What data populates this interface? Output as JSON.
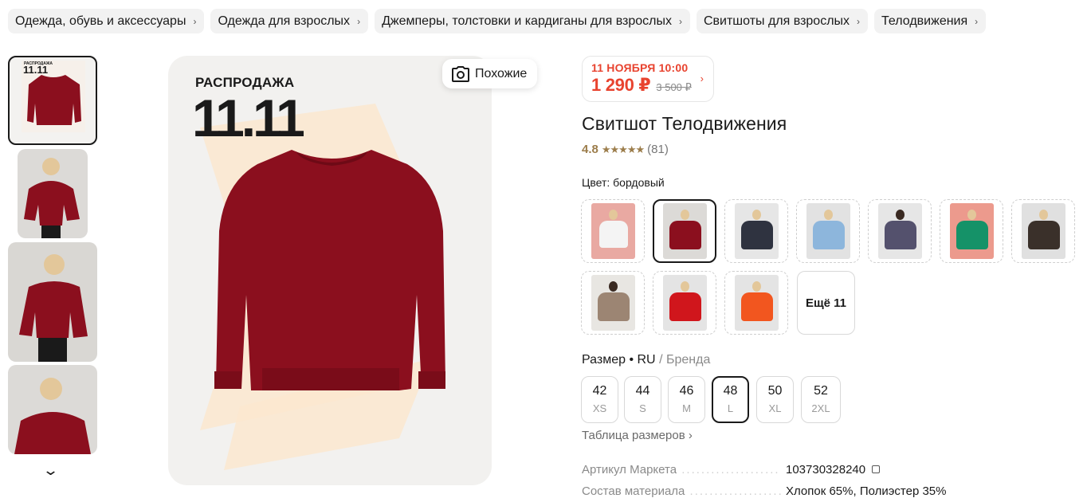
{
  "breadcrumbs": [
    {
      "label": "Одежда, обувь и аксессуары"
    },
    {
      "label": "Одежда для взрослых"
    },
    {
      "label": "Джемперы, толстовки и кардиганы для взрослых"
    },
    {
      "label": "Свитшоты для взрослых"
    },
    {
      "label": "Телодвижения"
    }
  ],
  "gallery": {
    "promo_line1": "РАСПРОДАЖА",
    "promo_line2": "11.11",
    "similar_label": "Похожие"
  },
  "offer": {
    "deal_date": "11 НОЯБРЯ 10:00",
    "price": "1 290 ₽",
    "old_price": "3 500 ₽"
  },
  "product": {
    "title": "Свитшот Телодвижения",
    "rating": "4.8",
    "reviews": "(81)"
  },
  "color": {
    "label": "Цвет:",
    "value": "бордовый",
    "more_label": "Ещё 11",
    "swatches": [
      "white",
      "burgundy",
      "dark-navy",
      "light-blue",
      "grey-purple",
      "green",
      "dark-brown",
      "beige",
      "red",
      "orange"
    ]
  },
  "sizes": {
    "label": "Размер",
    "system": "RU",
    "alt": "Бренда",
    "items": [
      {
        "ru": "42",
        "letter": "XS"
      },
      {
        "ru": "44",
        "letter": "S"
      },
      {
        "ru": "46",
        "letter": "M"
      },
      {
        "ru": "48",
        "letter": "L"
      },
      {
        "ru": "50",
        "letter": "XL"
      },
      {
        "ru": "52",
        "letter": "2XL"
      }
    ],
    "selected": "48",
    "table_link": "Таблица размеров"
  },
  "specs": [
    {
      "key": "Артикул Маркета",
      "value": "103730328240"
    },
    {
      "key": "Состав материала",
      "value": "Хлопок 65%, Полиэстер 35%"
    }
  ],
  "colors": {
    "accent_red": "#e8432f",
    "rating_gold": "#9c7d4b",
    "sweater_burgundy": "#8b0f1e"
  }
}
